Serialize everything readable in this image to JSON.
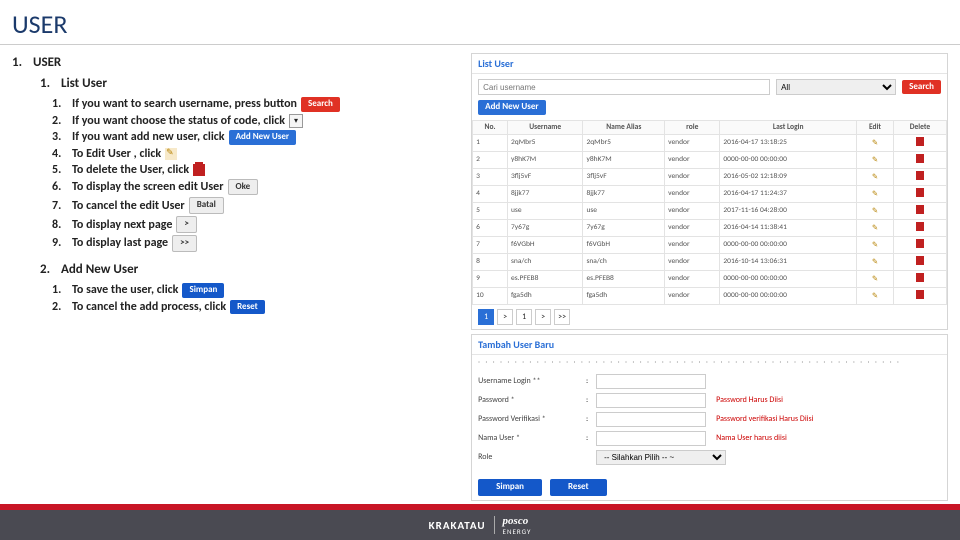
{
  "title": "USER",
  "h1": {
    "num": "1.",
    "label": "USER"
  },
  "listUser": {
    "num": "1.",
    "label": "List User",
    "items": [
      {
        "n": "1.",
        "t": "If you want to search username, press button",
        "btn": {
          "cls": "red",
          "label": "Search"
        }
      },
      {
        "n": "2.",
        "t": "If you want choose the status of code, click",
        "icon": "dropdown"
      },
      {
        "n": "3.",
        "t": "If you want add new user, click",
        "btn": {
          "cls": "blue",
          "label": "Add New User"
        }
      },
      {
        "n": "4.",
        "t": "To Edit User , click",
        "icon": "pencil"
      },
      {
        "n": "5.",
        "t": "To delete the User, click",
        "icon": "trash"
      },
      {
        "n": "6.",
        "t": "To display the screen edit User",
        "btn": {
          "cls": "gray",
          "label": "Oke"
        }
      },
      {
        "n": "7.",
        "t": "To cancel the edit User",
        "btn": {
          "cls": "gray",
          "label": "Batal"
        }
      },
      {
        "n": "8.",
        "t": "To display next page",
        "btn": {
          "cls": "gray",
          "label": ">"
        }
      },
      {
        "n": "9.",
        "t": "To display last page",
        "btn": {
          "cls": "gray",
          "label": ">>"
        }
      }
    ]
  },
  "addUser": {
    "num": "2.",
    "label": "Add New User",
    "items": [
      {
        "n": "1.",
        "t": "To save the user, click",
        "btn": {
          "cls": "blue2",
          "label": "Simpan"
        }
      },
      {
        "n": "2.",
        "t": "To cancel the add process, click",
        "btn": {
          "cls": "blue2",
          "label": "Reset"
        }
      }
    ]
  },
  "panel1": {
    "title": "List User",
    "searchPlaceholder": "Cari username",
    "statusDefault": "All",
    "searchBtn": "Search",
    "addBtn": "Add New User",
    "cols": [
      "No.",
      "Username",
      "Name Alias",
      "role",
      "Last Login",
      "Edit",
      "Delete"
    ],
    "rows": [
      [
        "1",
        "2qMbr5",
        "2qMbr5",
        "vendor",
        "2016-04-17 13:18:25"
      ],
      [
        "2",
        "y8hK7M",
        "y8hK7M",
        "vendor",
        "0000-00-00 00:00:00"
      ],
      [
        "3",
        "3flj5vF",
        "3flj5vF",
        "vendor",
        "2016-05-02 12:18:09"
      ],
      [
        "4",
        "8jjk77",
        "8jjk77",
        "vendor",
        "2016-04-17 11:24:37"
      ],
      [
        "5",
        "use",
        "use",
        "vendor",
        "2017-11-16 04:28:00"
      ],
      [
        "6",
        "7y67g",
        "7y67g",
        "vendor",
        "2016-04-14 11:38:41"
      ],
      [
        "7",
        "f6VGbH",
        "f6VGbH",
        "vendor",
        "0000-00-00 00:00:00"
      ],
      [
        "8",
        "sna/ch",
        "sna/ch",
        "vendor",
        "2016-10-14 13:06:31"
      ],
      [
        "9",
        "es.PFEB8",
        "es.PFEB8",
        "vendor",
        "0000-00-00 00:00:00"
      ],
      [
        "10",
        "fga5dh",
        "fga5dh",
        "vendor",
        "0000-00-00 00:00:00"
      ]
    ],
    "pager": [
      "1",
      ">",
      "1",
      ">",
      ">>"
    ]
  },
  "panel2": {
    "title": "Tambah User Baru",
    "fields": {
      "username": "Username Login **",
      "password": "Password *",
      "passwordErr": "Password Harus Diisi",
      "passwordVer": "Password Verifikasi *",
      "passwordVerErr": "Password verifikasi Harus Diisi",
      "namaUser": "Nama User *",
      "namaUserErr": "Nama User harus diisi",
      "role": "Role",
      "roleDefault": "-- Silahkan Pilih -- ~"
    },
    "btns": {
      "save": "Simpan",
      "reset": "Reset"
    }
  },
  "footer": {
    "brand1": "KRAKATAU",
    "brand2": "posco",
    "sub": "ENERGY"
  }
}
